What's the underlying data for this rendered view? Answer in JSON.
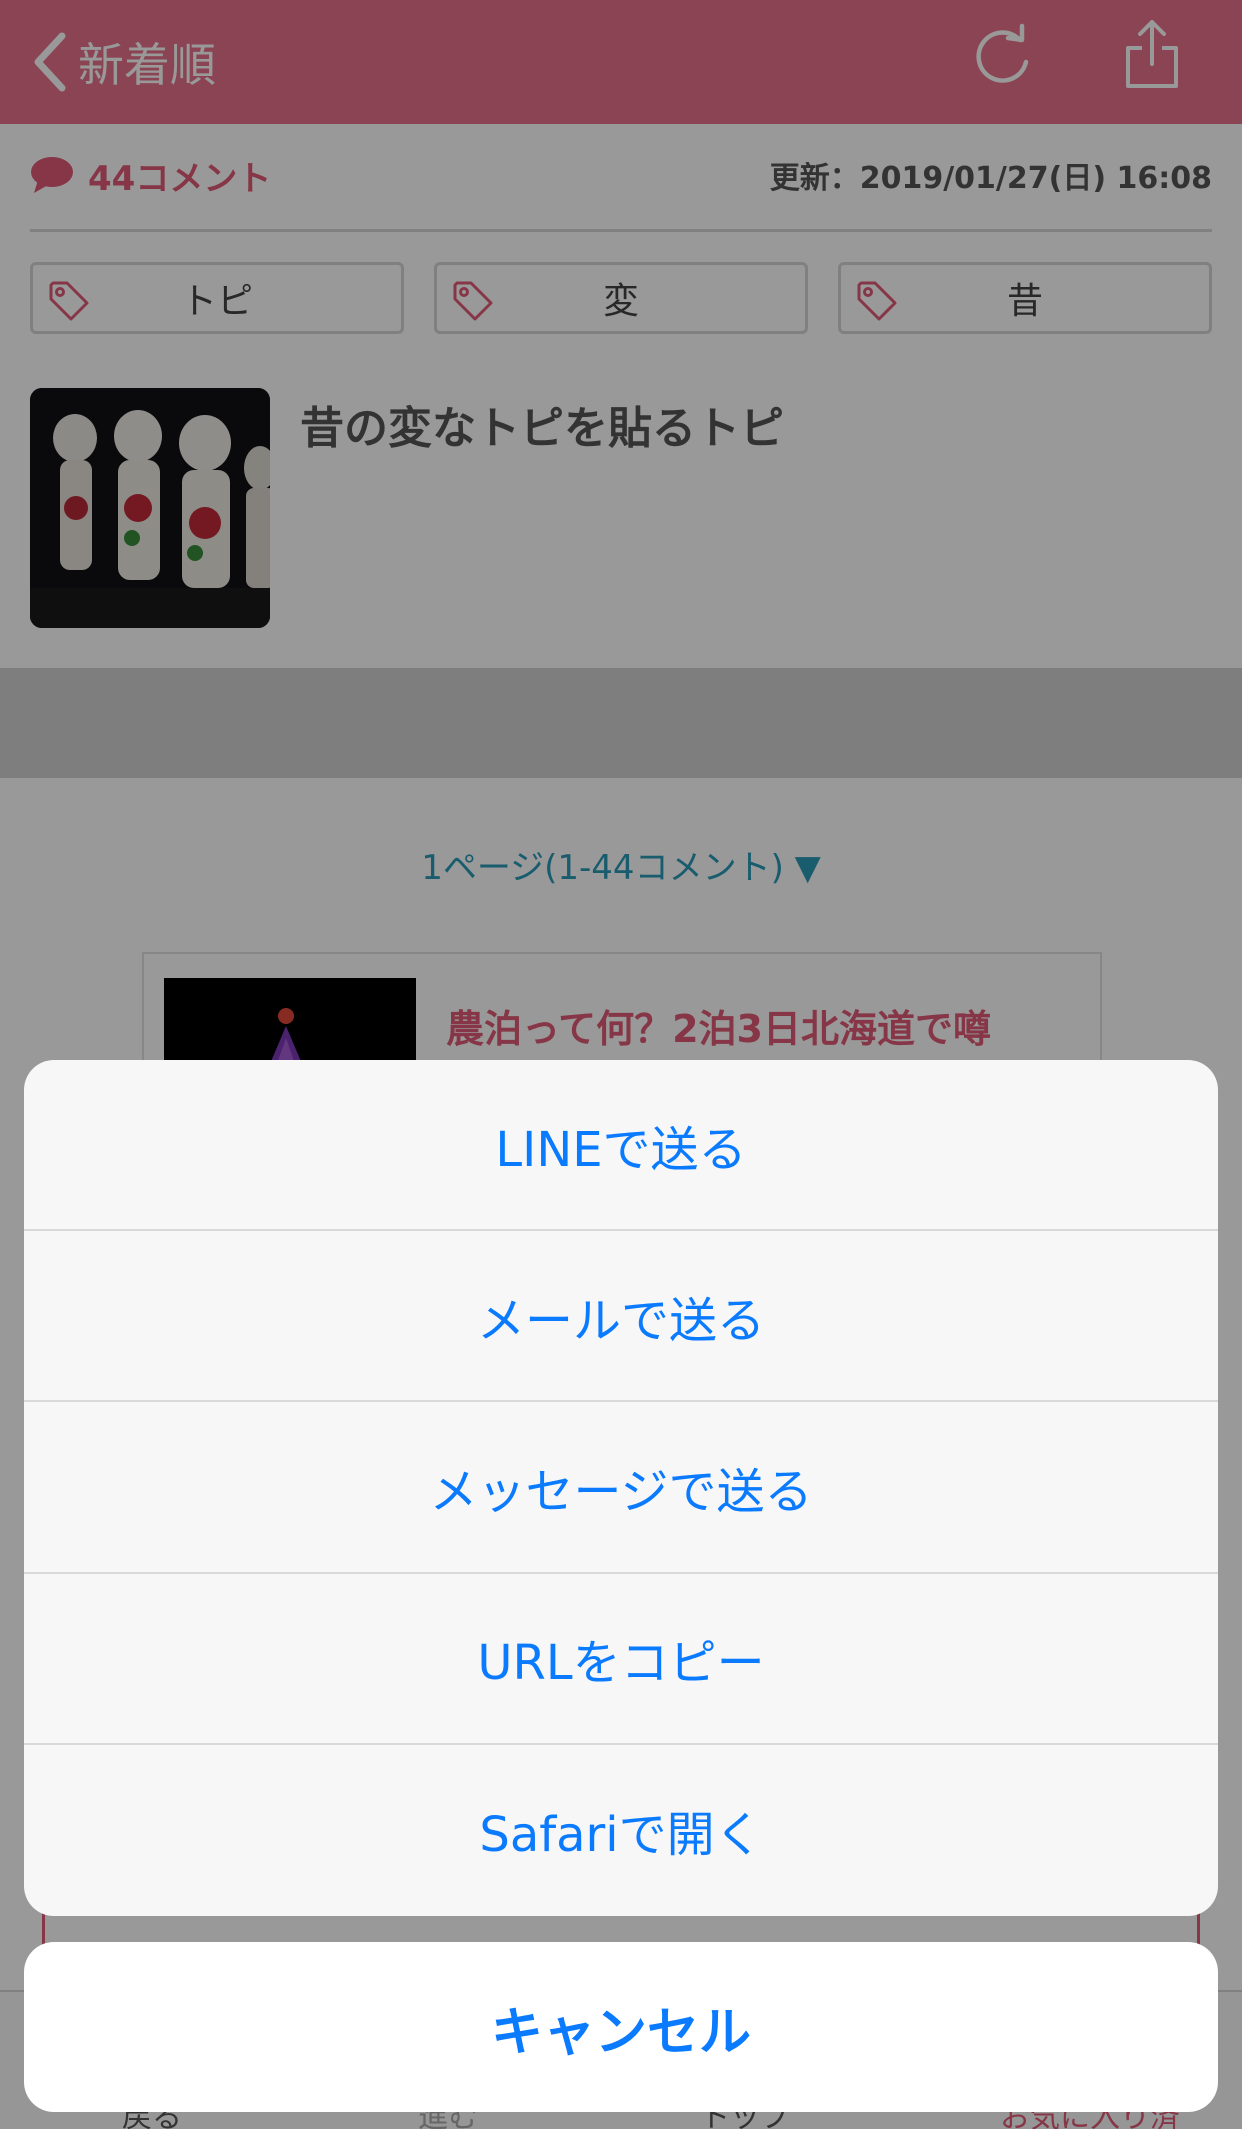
{
  "nav": {
    "back_label": "新着順",
    "reload_icon": "reload-icon",
    "share_icon": "share-icon",
    "bar_color": "#e8728a"
  },
  "topic_meta": {
    "comment_count": "44コメント",
    "updated": "更新：2019/01/27(日) 16:08"
  },
  "tags": [
    {
      "label": "トピ"
    },
    {
      "label": "変"
    },
    {
      "label": "昔"
    }
  ],
  "topic": {
    "title": "昔の変なトピを貼るトピ"
  },
  "pager": {
    "label": "1ページ(1-44コメント) ▼"
  },
  "article": {
    "title": "農泊って何？2泊3日北海道で噂"
  },
  "bottom_toolbar": {
    "back": "戻る",
    "next": "進む",
    "mid": "トップ",
    "fav": "お気に入り済"
  },
  "action_sheet": {
    "items": [
      {
        "label": "LINEで送る"
      },
      {
        "label": "メールで送る"
      },
      {
        "label": "メッセージで送る"
      },
      {
        "label": "URLをコピー"
      },
      {
        "label": "Safariで開く"
      }
    ],
    "cancel_label": "キャンセル",
    "accent_color": "#0a7aff"
  }
}
